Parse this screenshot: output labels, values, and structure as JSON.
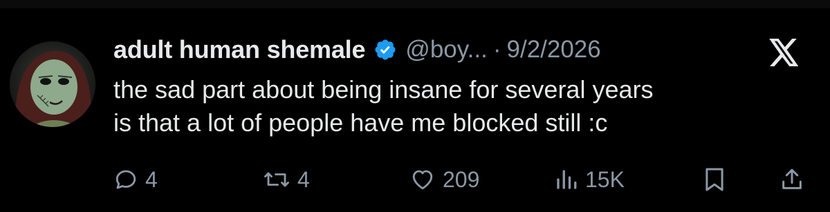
{
  "tweet": {
    "author": {
      "display_name": "adult human shemale",
      "handle": "@boy...",
      "verified": true
    },
    "separator": "·",
    "date": "9/2/2026",
    "text_lines": [
      "the sad part about being insane for several years",
      "is that a lot of people have me blocked still :c"
    ],
    "stats": {
      "replies": "4",
      "reposts": "4",
      "likes": "209",
      "views": "15K"
    }
  },
  "colors": {
    "background": "#000000",
    "text_primary": "#e7e9ea",
    "text_secondary": "#8b98a5",
    "verified_badge": "#1d9bf0"
  },
  "icons": {
    "brand": "x-logo-icon",
    "verified": "verified-badge-icon",
    "reply": "reply-icon",
    "repost": "repost-icon",
    "like": "heart-icon",
    "views": "views-chart-icon",
    "bookmark": "bookmark-icon",
    "share": "share-icon"
  }
}
